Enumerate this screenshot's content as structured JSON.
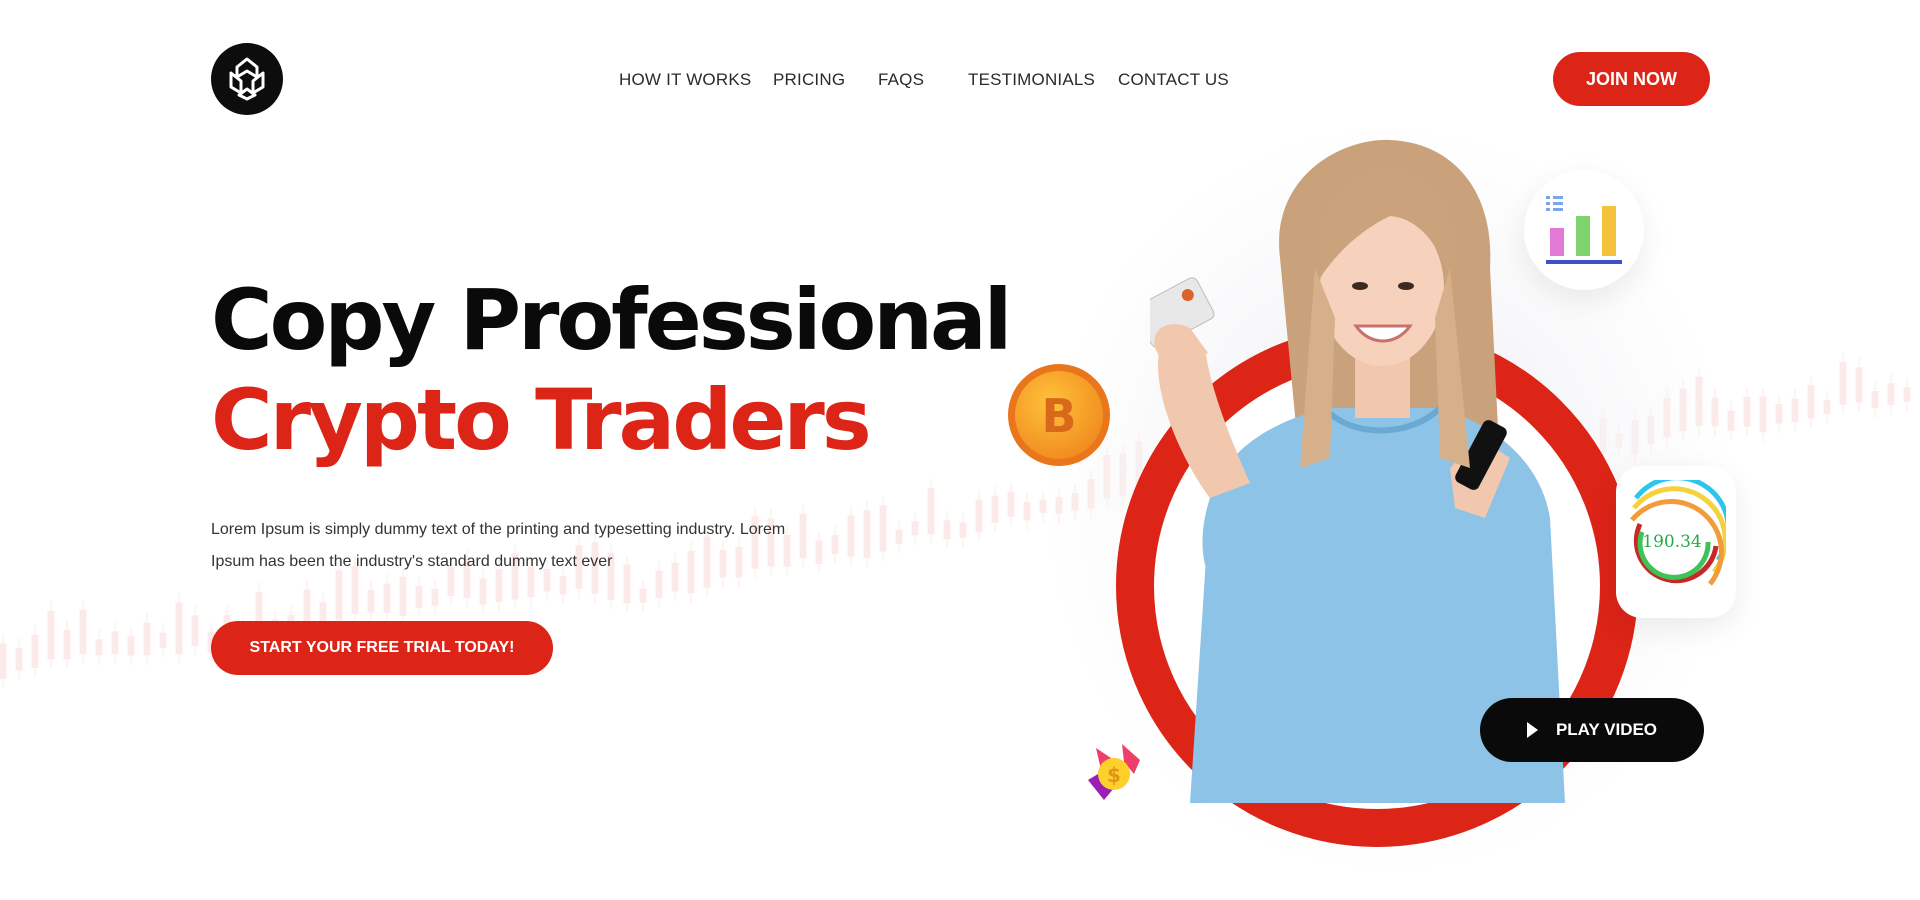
{
  "header": {
    "logo_icon": "logo-icon",
    "nav": [
      {
        "label": "HOW IT WORKS"
      },
      {
        "label": "PRICING"
      },
      {
        "label": "FAQS"
      },
      {
        "label": "TESTIMONIALS"
      },
      {
        "label": "CONTACT US"
      }
    ],
    "join_label": "JOIN NOW"
  },
  "hero": {
    "title_line1": "Copy Professional",
    "title_line2": "Crypto Traders",
    "description": "Lorem Ipsum is simply dummy text of the printing and typesetting industry. Lorem Ipsum has been the industry's standard dummy text ever",
    "cta_label": "START YOUR FREE TRIAL TODAY!"
  },
  "visual": {
    "gauge_value": "190.34",
    "play_label": "PLAY VIDEO",
    "icons": [
      "bitcoin-coin-icon",
      "bar-chart-icon",
      "gauge-chart-icon",
      "dollar-exchange-icon",
      "play-icon"
    ]
  },
  "colors": {
    "accent": "#dc2417",
    "dark": "#0a0a0a",
    "text": "#222222",
    "gauge_green": "#27a84a"
  }
}
